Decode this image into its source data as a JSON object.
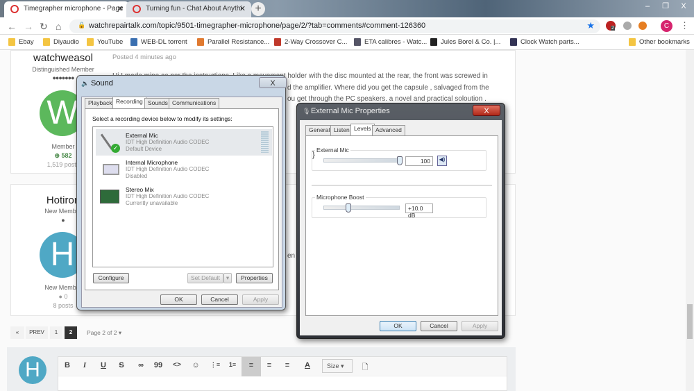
{
  "browser": {
    "tabs": [
      {
        "title": "Timegrapher microphone - Page",
        "active": true
      },
      {
        "title": "Turning fun - Chat About Anythi",
        "active": false
      }
    ],
    "new_tab": "+",
    "window_controls": [
      "–",
      "❐",
      "X"
    ],
    "url": "watchrepairtalk.com/topic/9501-timegrapher-microphone/page/2/?tab=comments#comment-126360",
    "extension_badge": "2",
    "profile_initial": "C",
    "bookmarks": [
      {
        "label": "Ebay",
        "color": "#f4c542"
      },
      {
        "label": "Diyaudio",
        "color": "#f4c542"
      },
      {
        "label": "YouTube",
        "color": "#f4c542"
      },
      {
        "label": "WEB-DL torrent",
        "color": "#3a6fb0"
      },
      {
        "label": "Parallel Resistance...",
        "color": "#e07a30"
      },
      {
        "label": "2-Way Crossover C...",
        "color": "#c0392b"
      },
      {
        "label": "ETA calibres - Watc...",
        "color": "#556"
      },
      {
        "label": "Jules Borel & Co. |...",
        "color": "#222"
      },
      {
        "label": "Clock Watch parts...",
        "color": "#335"
      }
    ],
    "other_bookmarks": "Other bookmarks"
  },
  "posts": [
    {
      "author": "watchweasol",
      "rank": "Distinguished Member",
      "initial": "W",
      "avatar_color": "#5cb85c",
      "group": "Member",
      "reputation": "582",
      "posts": "1,519 posts",
      "posted": "Posted 4 minutes ago",
      "body": [
        "Hi I made mine as per the instructions. Like a movement holder with the disc mounted at the rear, the front was screwed in",
        "d the amplifier.  Where did you get the capsule , salvaged from the",
        "ou get through the PC speakers.     a novel and practical soloution ."
      ]
    },
    {
      "author": "Hotiron",
      "rank": "New Member",
      "initial": "H",
      "avatar_color": "#4fa8c5",
      "group": "New Member",
      "reputation": "0",
      "posts": "8 posts",
      "body_fragment": "en"
    }
  ],
  "pagination": {
    "first": "«",
    "prev": "PREV",
    "pages": [
      "1",
      "2"
    ],
    "current": "2",
    "summary": "Page 2 of 2 ▾"
  },
  "editor": {
    "initial": "H",
    "tools": [
      "B",
      "I",
      "U",
      "S",
      "∞",
      "99",
      "<>",
      "☺",
      "⋮≡",
      "1≡",
      "≡",
      "≡",
      "≡",
      "A"
    ],
    "size_label": "Size"
  },
  "sound_dialog": {
    "title": "Sound",
    "close": "X",
    "tabs": [
      "Playback",
      "Recording",
      "Sounds",
      "Communications"
    ],
    "active_tab": "Recording",
    "instruction": "Select a recording device below to modify its settings:",
    "devices": [
      {
        "name": "External Mic",
        "driver": "IDT High Definition Audio CODEC",
        "status": "Default Device",
        "selected": true
      },
      {
        "name": "Internal Microphone",
        "driver": "IDT High Definition Audio CODEC",
        "status": "Disabled"
      },
      {
        "name": "Stereo Mix",
        "driver": "IDT High Definition Audio CODEC",
        "status": "Currently unavailable"
      }
    ],
    "buttons": {
      "configure": "Configure",
      "set_default": "Set Default",
      "properties": "Properties",
      "ok": "OK",
      "cancel": "Cancel",
      "apply": "Apply"
    }
  },
  "props_dialog": {
    "title": "External Mic Properties",
    "close": "X",
    "tabs": [
      "General",
      "Listen",
      "Levels",
      "Advanced"
    ],
    "active_tab": "Levels",
    "mic_label": "External Mic",
    "mic_level": "100",
    "mic_level_percent": 100,
    "boost_label": "Microphone Boost",
    "boost_value": "+10.0 dB",
    "boost_fraction": 0.33,
    "buttons": {
      "ok": "OK",
      "cancel": "Cancel",
      "apply": "Apply"
    }
  }
}
